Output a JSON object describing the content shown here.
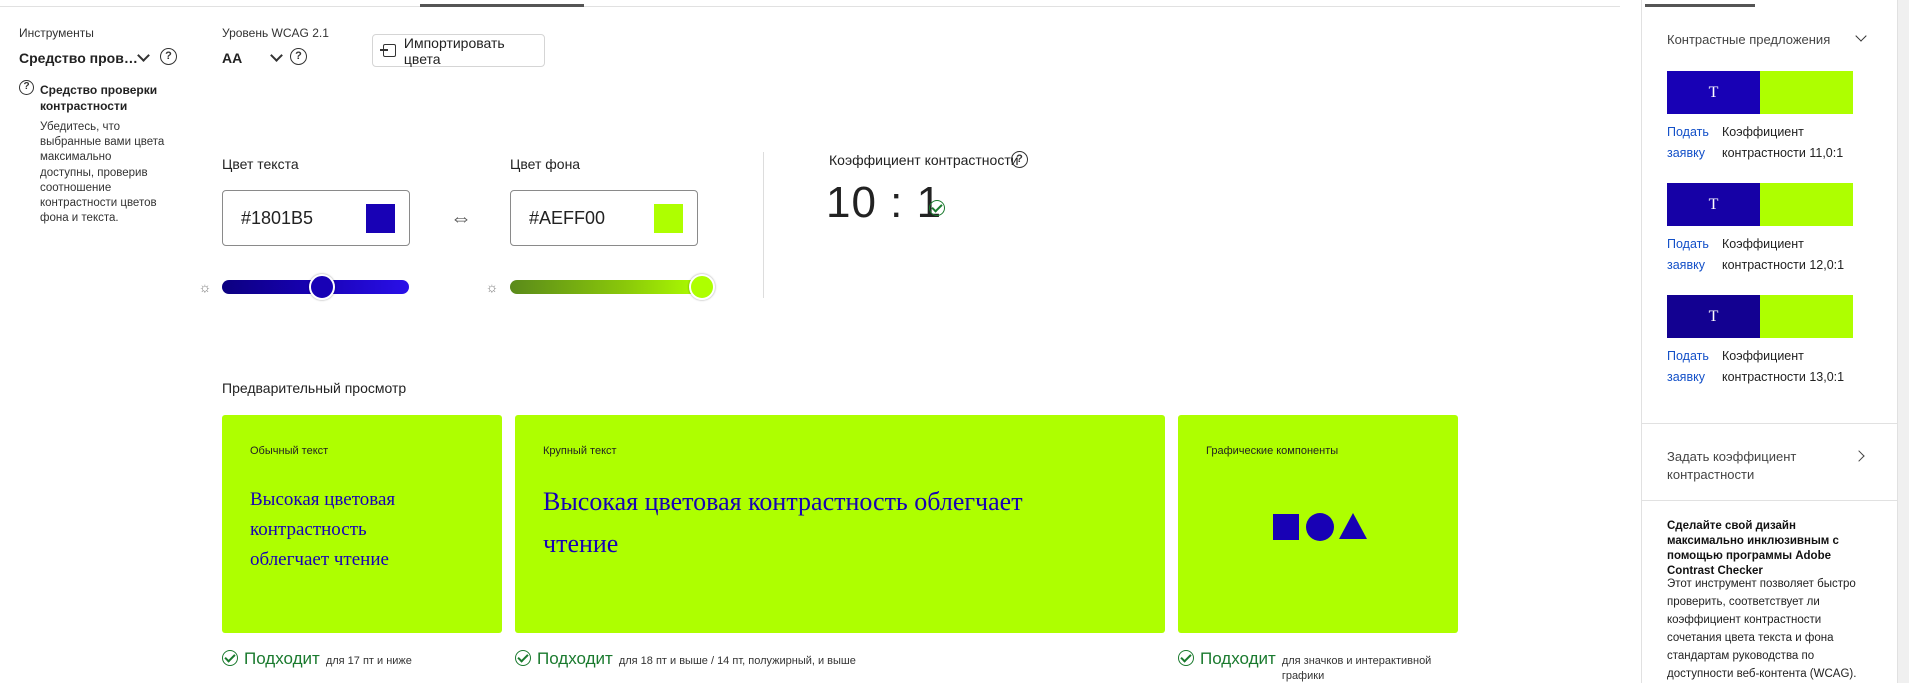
{
  "tools": {
    "label": "Инструменты",
    "selected": "Средство пров…"
  },
  "wcag": {
    "label": "Уровень WCAG 2.1",
    "selected": "AA"
  },
  "import_button": "Импортировать цвета",
  "description": {
    "title": "Средство проверки контрастности",
    "text": "Убедитесь, что выбранные вами цвета максимально доступны, проверив соотношение контрастности цветов фона и текста."
  },
  "text_color": {
    "label": "Цвет текста",
    "value": "#1801B5",
    "swatch": "#1801b5",
    "brightness": 0.5
  },
  "bg_color": {
    "label": "Цвет фона",
    "value": "#AEFF00",
    "swatch": "#aeff00",
    "brightness": 1.0
  },
  "contrast": {
    "label": "Коэффициент контрастности",
    "ratio": "10 : 1"
  },
  "preview": {
    "label": "Предварительный просмотр",
    "cards": [
      {
        "label": "Обычный текст",
        "text": "Высокая цветовая контрастность облегчает чтение"
      },
      {
        "label": "Крупный текст",
        "text": "Высокая цветовая контрастность облегчает чтение"
      },
      {
        "label": "Графические компоненты"
      }
    ],
    "results": [
      {
        "status": "Подходит",
        "note": "для 17 пт и ниже"
      },
      {
        "status": "Подходит",
        "note": "для 18 пт и выше / 14 пт, полужирный, и выше"
      },
      {
        "status": "Подходит",
        "note": "для значков и интерактивной графики"
      }
    ]
  },
  "sidebar": {
    "suggestions_title": "Контрастные предложения",
    "suggestions": [
      {
        "glyph": "T",
        "link": "Подать заявку",
        "ratio": "Коэффициент контрастности 11,0:1",
        "text_color": "#1801b5"
      },
      {
        "glyph": "T",
        "link": "Подать заявку",
        "ratio": "Коэффициент контрастности 12,0:1",
        "text_color": "#1601a6"
      },
      {
        "glyph": "T",
        "link": "Подать заявку",
        "ratio": "Коэффициент контрастности 13,0:1",
        "text_color": "#130191"
      }
    ],
    "set_ratio": "Задать коэффициент контрастности",
    "promo_title": "Сделайте свой дизайн максимально инклюзивным с помощью программы Adobe Contrast Checker",
    "promo_text": "Этот инструмент позволяет быстро проверить, соответствует ли коэффициент контрастности сочетания цвета текста и фона стандартам руководства по доступности веб-контента (WCAG)."
  },
  "colors": {
    "accent_text": "#1801b5",
    "accent_bg": "#aeff00",
    "pass_green": "#1a7a2e",
    "link_blue": "#1350c8"
  }
}
